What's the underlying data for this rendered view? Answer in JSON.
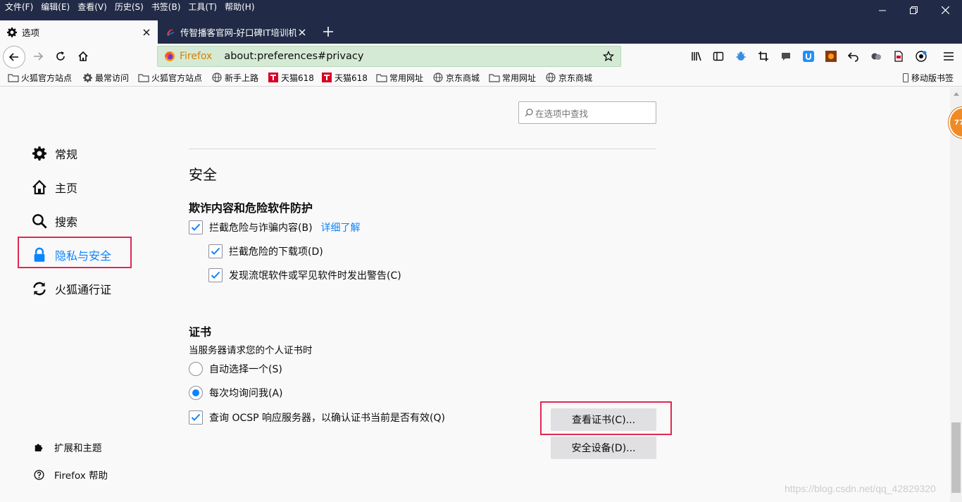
{
  "menu": [
    "文件(F)",
    "编辑(E)",
    "查看(V)",
    "历史(S)",
    "书签(B)",
    "工具(T)",
    "帮助(H)"
  ],
  "tabs": [
    {
      "title": "选项",
      "icon": "gear-icon",
      "active": true
    },
    {
      "title": "传智播客官网-好口碑IT培训机",
      "icon": "site-icon",
      "active": false
    }
  ],
  "urlbar": {
    "identity": "Firefox",
    "url": "about:preferences#privacy"
  },
  "bookmarks": [
    {
      "label": "火狐官方站点",
      "icon": "folder-icon"
    },
    {
      "label": "最常访问",
      "icon": "gear-icon"
    },
    {
      "label": "火狐官方站点",
      "icon": "folder-icon"
    },
    {
      "label": "新手上路",
      "icon": "globe-icon"
    },
    {
      "label": "天猫618",
      "icon": "tmall-icon"
    },
    {
      "label": "天猫618",
      "icon": "tmall-icon"
    },
    {
      "label": "常用网址",
      "icon": "folder-icon"
    },
    {
      "label": "京东商城",
      "icon": "globe-icon"
    },
    {
      "label": "常用网址",
      "icon": "folder-icon"
    },
    {
      "label": "京东商城",
      "icon": "globe-icon"
    }
  ],
  "mobile_bookmarks": "移动版书签",
  "search": {
    "placeholder": "在选项中查找"
  },
  "sidebar": {
    "categories": [
      {
        "label": "常规",
        "icon": "gear-icon"
      },
      {
        "label": "主页",
        "icon": "home-icon"
      },
      {
        "label": "搜索",
        "icon": "search-icon"
      },
      {
        "label": "隐私与安全",
        "icon": "lock-icon",
        "selected": true
      },
      {
        "label": "火狐通行证",
        "icon": "sync-icon"
      }
    ],
    "footer": [
      {
        "label": "扩展和主题",
        "icon": "puzzle-icon"
      },
      {
        "label": "Firefox 帮助",
        "icon": "help-icon"
      }
    ]
  },
  "security": {
    "heading": "安全",
    "deceptive_title": "欺诈内容和危险软件防护",
    "block_dangerous": "拦截危险与诈骗内容(B)",
    "learn_more": "详细了解",
    "block_downloads": "拦截危险的下载项(D)",
    "warn_unwanted": "发现流氓软件或罕见软件时发出警告(C)"
  },
  "certificates": {
    "title": "证书",
    "description": "当服务器请求您的个人证书时",
    "auto_select": "自动选择一个(S)",
    "ask_every_time": "每次均询问我(A)",
    "ocsp": "查询 OCSP 响应服务器，以确认证书当前是否有效(Q)",
    "view_button": "查看证书(C)...",
    "devices_button": "安全设备(D)..."
  },
  "floater_badge": "77",
  "watermark": "https://blog.csdn.net/qq_42829320",
  "colors": {
    "accent": "#0a84ff",
    "highlight_box": "#e22850",
    "chrome": "#212b47"
  }
}
